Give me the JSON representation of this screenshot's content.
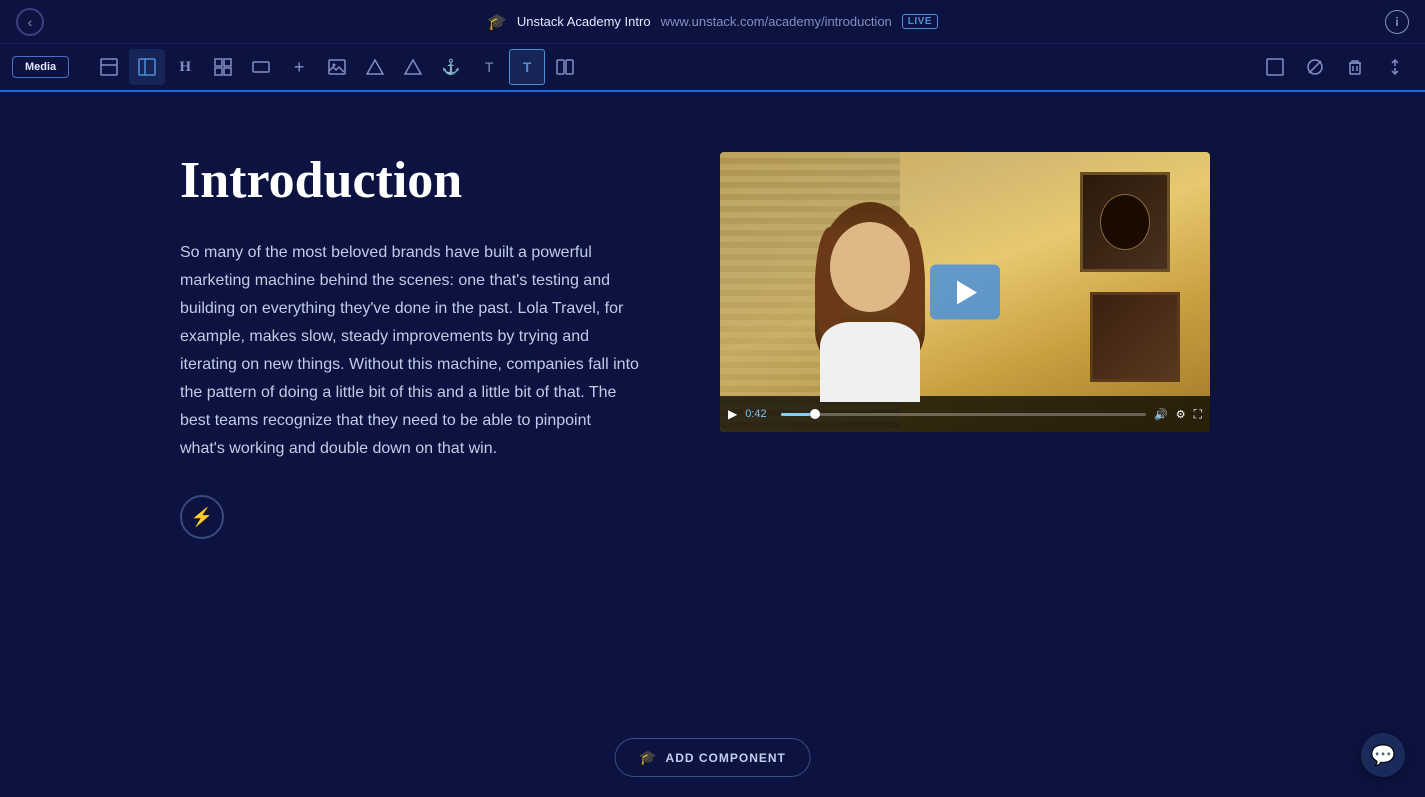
{
  "topbar": {
    "back_label": "‹",
    "page_icon": "🎓",
    "page_title": "Unstack Academy Intro",
    "page_url": "www.unstack.com/academy/introduction",
    "live_badge": "LIVE",
    "info_label": "i"
  },
  "toolbar": {
    "media_button": "Media",
    "icons": [
      {
        "name": "layout-icon",
        "symbol": "▬",
        "active": false
      },
      {
        "name": "sidebar-layout-icon",
        "symbol": "⊟",
        "active": true
      },
      {
        "name": "heading-icon",
        "symbol": "H",
        "active": false
      },
      {
        "name": "grid-icon",
        "symbol": "⊞",
        "active": false
      },
      {
        "name": "section-icon",
        "symbol": "▭",
        "active": false
      },
      {
        "name": "plus-icon",
        "symbol": "+",
        "active": false
      },
      {
        "name": "image-icon",
        "symbol": "🖼",
        "active": false
      },
      {
        "name": "shape-icon",
        "symbol": "◇",
        "active": false
      },
      {
        "name": "triangle-icon",
        "symbol": "△",
        "active": false
      },
      {
        "name": "anchor-icon",
        "symbol": "⚓",
        "active": false
      },
      {
        "name": "text-icon",
        "symbol": "T",
        "active": false
      },
      {
        "name": "text-bold-icon",
        "symbol": "T",
        "active": false
      },
      {
        "name": "columns-icon",
        "symbol": "▯▯",
        "active": false
      }
    ],
    "right_icons": [
      {
        "name": "expand-icon",
        "symbol": "⛶"
      },
      {
        "name": "hide-icon",
        "symbol": "◎"
      },
      {
        "name": "delete-icon",
        "symbol": "🗑"
      },
      {
        "name": "reorder-icon",
        "symbol": "⇅"
      }
    ]
  },
  "content": {
    "title": "Introduction",
    "body": "So many of the most beloved brands have built a powerful marketing machine behind the scenes: one that's testing and building on everything they've done in the past. Lola Travel, for example, makes slow, steady improvements by trying and iterating on new things. Without this machine, companies fall into the pattern of doing a little bit of this and a little bit of that. The best teams recognize that they need to be able to pinpoint what's working and double down on that win.",
    "action_icon": "⚡"
  },
  "video": {
    "time": "0:42",
    "progress_pct": 8
  },
  "add_component": {
    "label": "ADD COMPONENT",
    "icon": "🎓"
  },
  "chat": {
    "icon": "💬"
  }
}
